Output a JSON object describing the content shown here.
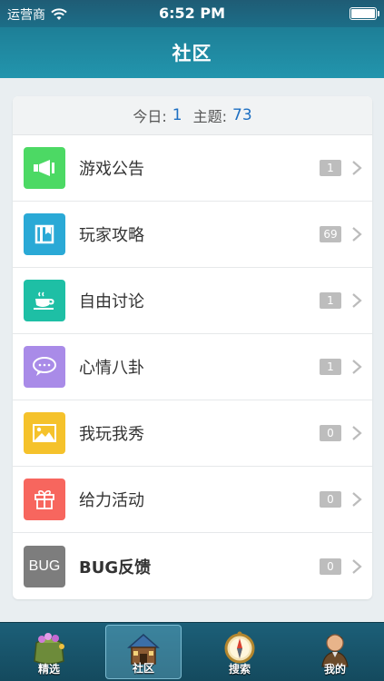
{
  "status_bar": {
    "carrier": "运营商",
    "time": "6:52 PM"
  },
  "nav": {
    "title": "社区"
  },
  "stats": {
    "today_label": "今日:",
    "today_value": "1",
    "topics_label": "主题:",
    "topics_value": "73"
  },
  "forums": [
    {
      "label": "游戏公告",
      "count": "1",
      "icon": "megaphone-icon",
      "color": "#4cd964"
    },
    {
      "label": "玩家攻略",
      "count": "69",
      "icon": "book-icon",
      "color": "#2aa9d6"
    },
    {
      "label": "自由讨论",
      "count": "1",
      "icon": "coffee-icon",
      "color": "#1ebfa5"
    },
    {
      "label": "心情八卦",
      "count": "1",
      "icon": "chat-bubble-icon",
      "color": "#a98be8"
    },
    {
      "label": "我玩我秀",
      "count": "0",
      "icon": "picture-icon",
      "color": "#f5c22b"
    },
    {
      "label": "给力活动",
      "count": "0",
      "icon": "gift-icon",
      "color": "#f7665e"
    },
    {
      "label": "BUG反馈",
      "count": "0",
      "icon": "bug-text-icon",
      "color": "#7d7d7d",
      "icon_text": "BUG"
    }
  ],
  "tabs": [
    {
      "label": "精选",
      "icon": "treasure-bag-icon",
      "active": false
    },
    {
      "label": "社区",
      "icon": "house-icon",
      "active": true
    },
    {
      "label": "搜索",
      "icon": "compass-icon",
      "active": false
    },
    {
      "label": "我的",
      "icon": "character-icon",
      "active": false
    }
  ]
}
